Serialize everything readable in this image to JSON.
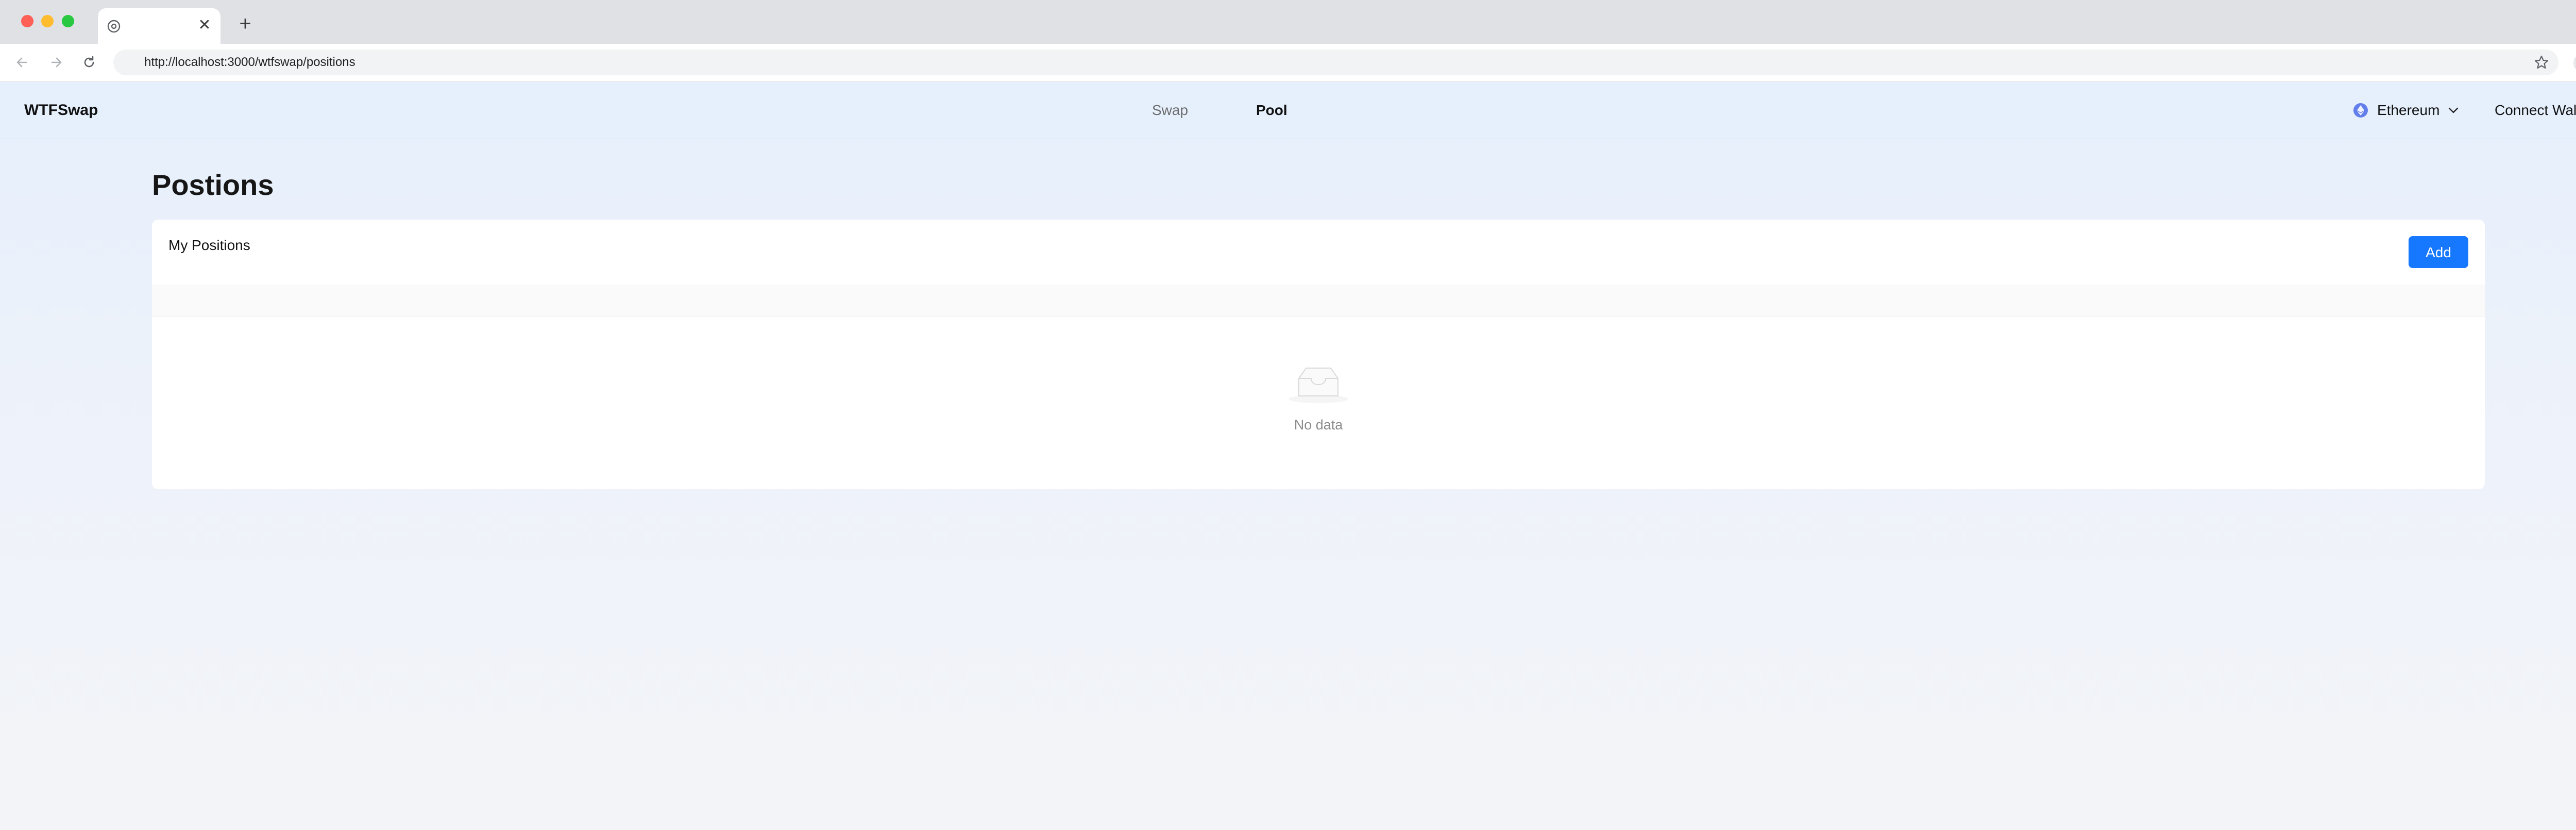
{
  "browser": {
    "address": "http://localhost:3000/wtfswap/positions"
  },
  "app": {
    "logo": "WTFSwap",
    "nav": {
      "swap": "Swap",
      "pool": "Pool"
    },
    "network": {
      "label": "Ethereum",
      "icon": "ethereum-icon"
    },
    "connect_label": "Connect Wallet"
  },
  "page": {
    "title": "Postions",
    "card_title": "My Positions",
    "add_label": "Add",
    "empty_text": "No data"
  },
  "colors": {
    "primary": "#1677ff",
    "header_bg": "#e6f0fd",
    "ethereum": "#627eea"
  }
}
